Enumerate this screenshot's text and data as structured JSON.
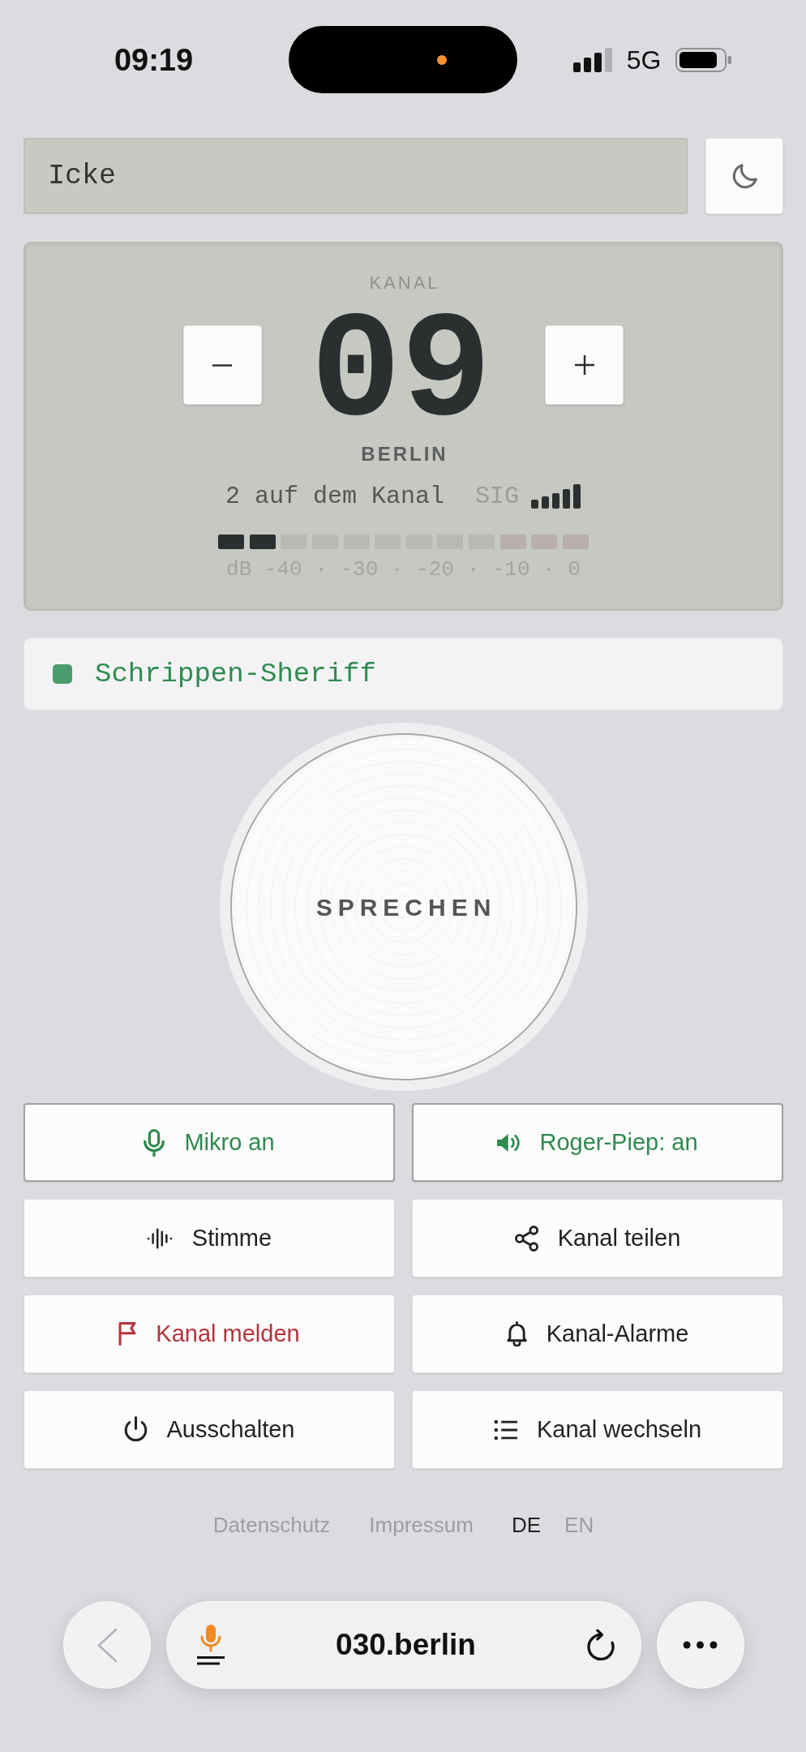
{
  "status_bar": {
    "time": "09:19",
    "network": "5G"
  },
  "name_field": {
    "value": "Icke"
  },
  "display": {
    "label": "KANAL",
    "channel": "09",
    "city": "BERLIN",
    "listeners": "2 auf dem Kanal",
    "signal_label": "SIG",
    "meter": {
      "level": 0.1667
    },
    "scale": "dB -40 · -30 · -20 · -10 · 0"
  },
  "speaker": {
    "name": "Schrippen-Sheriff",
    "color": "#4a9c6d"
  },
  "talk_button": {
    "label": "SPRECHEN"
  },
  "actions": [
    {
      "kind": "toggle",
      "label": "Mikro an",
      "on": true
    },
    {
      "kind": "toggle",
      "label": "Roger-Piep: an",
      "on": true
    },
    {
      "kind": "action",
      "label": "Stimme"
    },
    {
      "kind": "action",
      "label": "Kanal teilen"
    },
    {
      "kind": "danger",
      "label": "Kanal melden"
    },
    {
      "kind": "action",
      "label": "Kanal-Alarme"
    },
    {
      "kind": "action",
      "label": "Ausschalten"
    },
    {
      "kind": "action",
      "label": "Kanal wechseln"
    }
  ],
  "footer": {
    "links": [
      "Datenschutz",
      "Impressum"
    ],
    "languages": [
      {
        "label": "DE",
        "selected": true
      },
      {
        "label": "EN",
        "selected": false
      }
    ]
  },
  "browser_bar": {
    "url": "030.berlin"
  }
}
